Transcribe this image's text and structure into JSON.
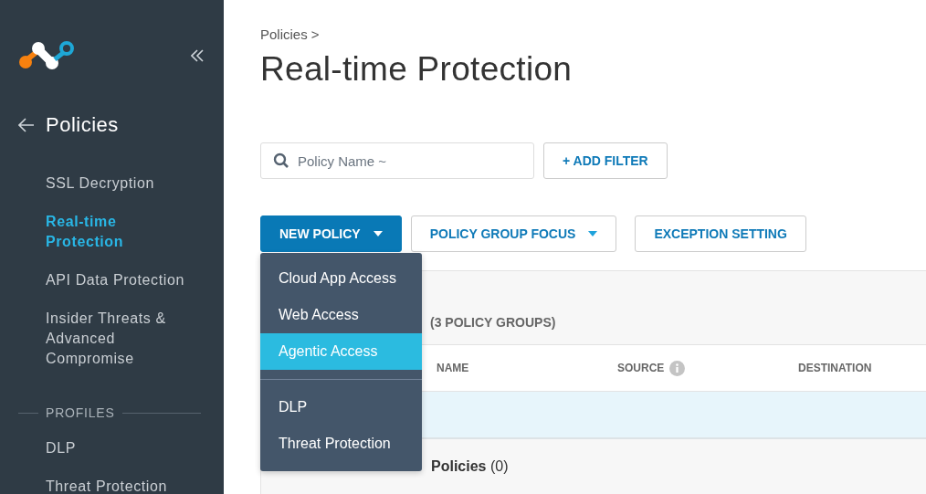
{
  "sidebar": {
    "title": "Policies",
    "items": [
      {
        "label": "SSL Decryption",
        "selected": false
      },
      {
        "label": "Real-time Protection",
        "selected": true
      },
      {
        "label": "API Data Protection",
        "selected": false
      },
      {
        "label": "Insider Threats & Advanced Compromise",
        "selected": false
      }
    ],
    "section": {
      "label": "PROFILES",
      "items": [
        {
          "label": "DLP",
          "selected": false
        },
        {
          "label": "Threat Protection",
          "selected": false
        }
      ]
    }
  },
  "breadcrumb": "Policies >",
  "title": "Real-time Protection",
  "search": {
    "placeholder": "Policy Name ~"
  },
  "add_filter": "+ ADD FILTER",
  "toolbar": [
    {
      "label": "NEW POLICY",
      "kind": "primary",
      "dropdown": true
    },
    {
      "label": "POLICY GROUP FOCUS",
      "kind": "outline",
      "dropdown": true
    },
    {
      "label": "EXCEPTION SETTING",
      "kind": "outline",
      "dropdown": false
    }
  ],
  "menu": {
    "sections": [
      {
        "items": [
          {
            "label": "Cloud App Access",
            "selected": false
          },
          {
            "label": "Web Access",
            "selected": false
          },
          {
            "label": "Agentic Access",
            "selected": true
          }
        ]
      },
      {
        "items": [
          {
            "label": "DLP",
            "selected": false
          },
          {
            "label": "Threat Protection",
            "selected": false
          }
        ]
      }
    ]
  },
  "table": {
    "summary": "(3 POLICY GROUPS)",
    "columns": [
      {
        "label": "NAME",
        "info": false
      },
      {
        "label": "SOURCE",
        "info": true
      },
      {
        "label": "DESTINATION",
        "info": false
      }
    ],
    "group": {
      "name": "Policies",
      "count": "(0)"
    }
  }
}
